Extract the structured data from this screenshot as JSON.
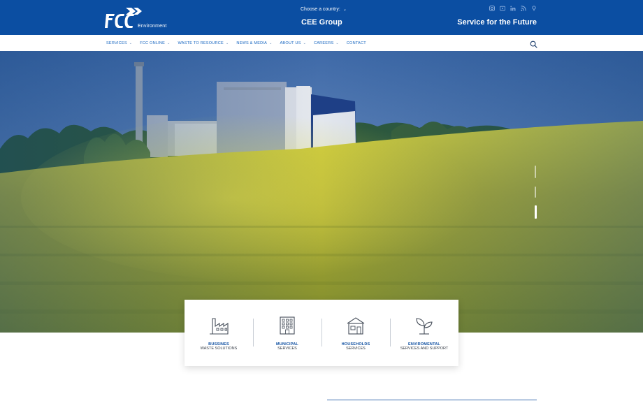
{
  "header": {
    "logo_text": "FCC",
    "logo_sub": "Environment",
    "country_label": "Choose a country:",
    "group_title": "CEE Group",
    "tagline": "Service for the Future",
    "social_icons": [
      "instagram-icon",
      "youtube-icon",
      "linkedin-icon",
      "rss-icon",
      "podcast-icon"
    ]
  },
  "nav": {
    "items": [
      {
        "label": "SERVICES",
        "has_dropdown": true
      },
      {
        "label": "FCC ONLINE",
        "has_dropdown": true
      },
      {
        "label": "WASTE TO RESOURCE",
        "has_dropdown": true
      },
      {
        "label": "NEWS & MEDIA",
        "has_dropdown": true
      },
      {
        "label": "ABOUT US",
        "has_dropdown": true
      },
      {
        "label": "CAREERS",
        "has_dropdown": true
      },
      {
        "label": "CONTACT",
        "has_dropdown": false
      }
    ],
    "search_icon": "search-icon"
  },
  "hero": {
    "slide_count": 3,
    "active_slide": 3
  },
  "services": [
    {
      "title": "BUSSINES",
      "subtitle": "WASTE SOLUTIONS",
      "icon": "factory-icon"
    },
    {
      "title": "MUNICIPAL",
      "subtitle": "SERVICES",
      "icon": "building-icon"
    },
    {
      "title": "HOUSEHOLDS",
      "subtitle": "SERVICES",
      "icon": "house-icon"
    },
    {
      "title": "ENVIROMENTAL",
      "subtitle": "SERVICES AND SUPPORT",
      "icon": "sprout-icon"
    }
  ],
  "colors": {
    "brand_blue": "#0b4ea2",
    "nav_text": "#1565c0",
    "field_yellow": "#c9c63a"
  }
}
